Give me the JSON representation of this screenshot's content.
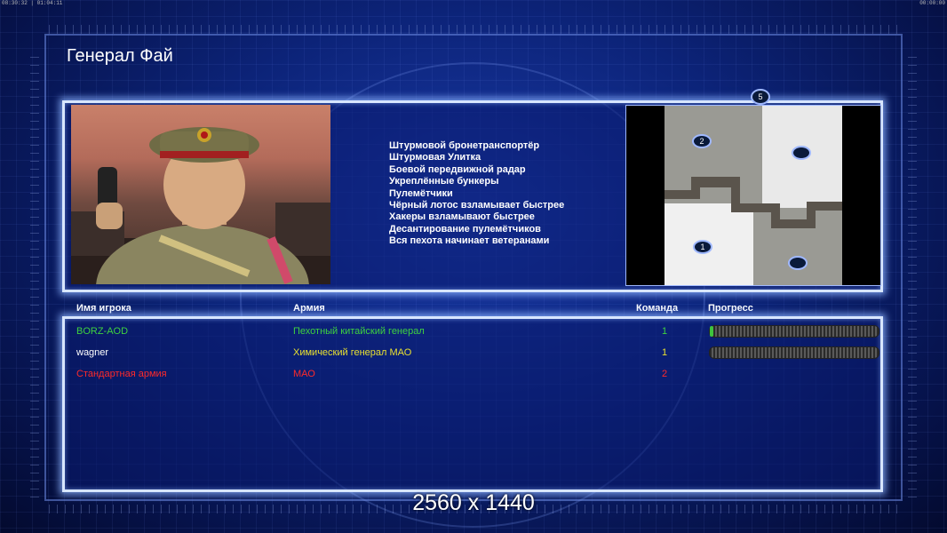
{
  "osd": {
    "left": "08:30:32 | 01:04:11",
    "right": "00:00:00"
  },
  "general_title": "Генерал Фай",
  "features": [
    "Штурмовой бронетранспортёр",
    "Штурмовая Улитка",
    "Боевой передвижной радар",
    "Укреплённые бункеры",
    "Пулемётчики",
    "Чёрный лотос взламывает быстрее",
    "Хакеры взламывают быстрее",
    "Десантирование пулемётчиков",
    "Вся пехота начинает ветеранами"
  ],
  "map": {
    "slot_top": "5",
    "start_a": "2",
    "start_b": "1"
  },
  "table": {
    "headers": {
      "name": "Имя игрока",
      "army": "Армия",
      "team": "Команда",
      "progress": "Прогресс"
    },
    "rows": [
      {
        "name": "BORZ-AOD",
        "army": "Пехотный китайский генерал",
        "team": "1",
        "color": "#3fd23f",
        "progress": 0.02
      },
      {
        "name": "wagner",
        "army": "Химический генерал МАО",
        "team": "1",
        "color": "#e8e030",
        "progress": 0.0
      },
      {
        "name": "Стандартная армия",
        "army": "МАО",
        "team": "2",
        "color": "#ff2a2a",
        "progress": null
      }
    ]
  },
  "resolution_label": "2560 x 1440"
}
